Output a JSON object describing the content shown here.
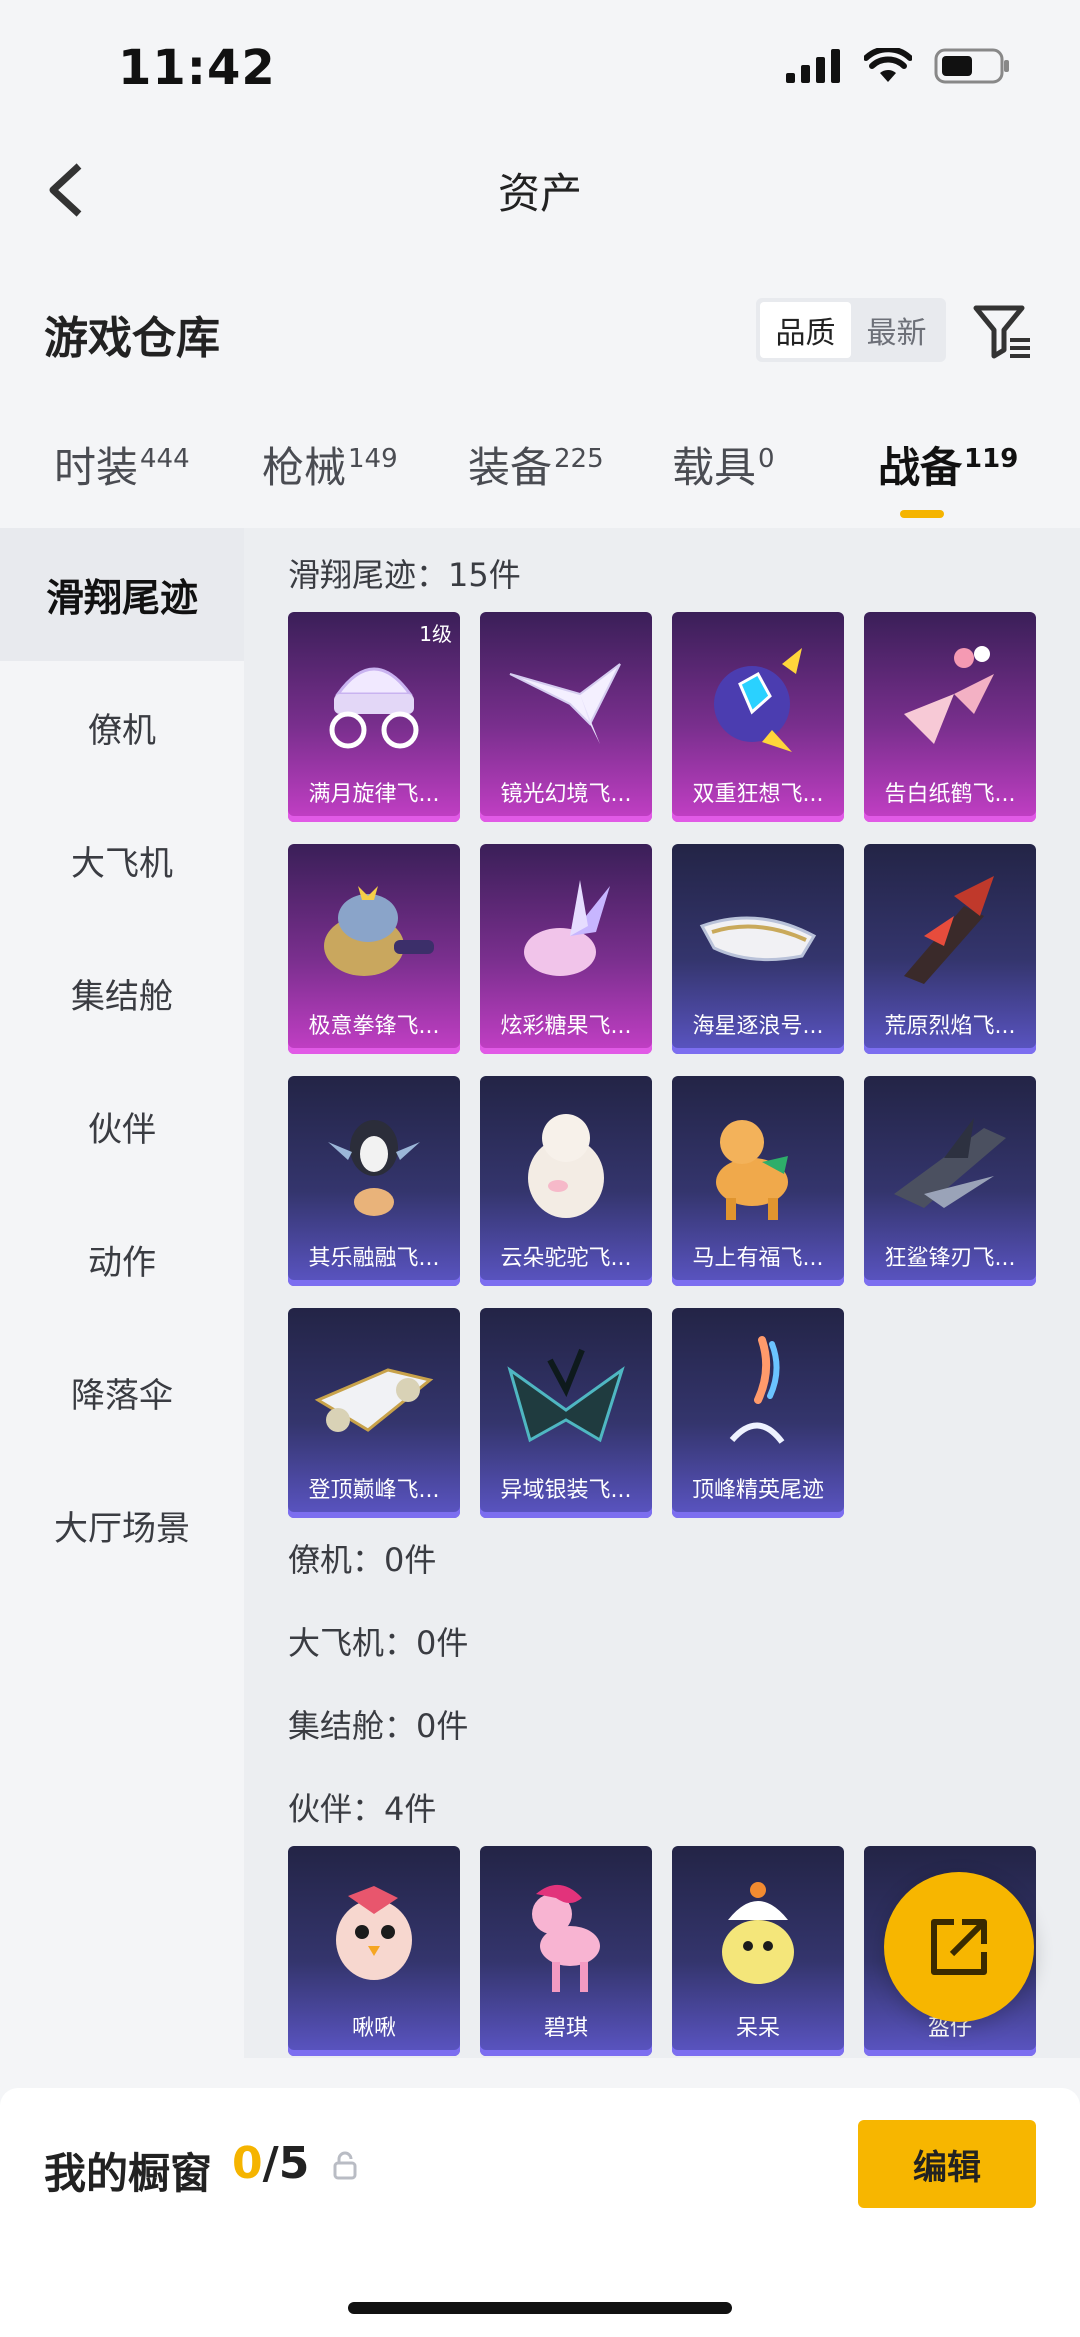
{
  "status": {
    "time": "11:42"
  },
  "nav": {
    "title": "资产"
  },
  "header": {
    "title": "游戏仓库",
    "sort": [
      "品质",
      "最新"
    ]
  },
  "tabs": [
    {
      "label": "时装",
      "count": "444"
    },
    {
      "label": "枪械",
      "count": "149"
    },
    {
      "label": "装备",
      "count": "225"
    },
    {
      "label": "载具",
      "count": "0"
    },
    {
      "label": "战备",
      "count": "119"
    }
  ],
  "sidebar": [
    "滑翔尾迹",
    "僚机",
    "大飞机",
    "集结舱",
    "伙伴",
    "动作",
    "降落伞",
    "大厅场景"
  ],
  "groups": {
    "trails": {
      "title": "滑翔尾迹：15件",
      "items": [
        {
          "name": "满月旋律飞...",
          "badge": "1级",
          "icon": "carriage"
        },
        {
          "name": "镜光幻境飞...",
          "icon": "wings"
        },
        {
          "name": "双重狂想飞...",
          "icon": "bomb"
        },
        {
          "name": "告白纸鹤飞...",
          "icon": "paper-crane"
        },
        {
          "name": "极意拳锋飞...",
          "icon": "elephant"
        },
        {
          "name": "炫彩糖果飞...",
          "icon": "candy"
        },
        {
          "name": "海星逐浪号...",
          "icon": "boat"
        },
        {
          "name": "荒原烈焰飞...",
          "icon": "flame-glider"
        },
        {
          "name": "其乐融融飞...",
          "icon": "penguin"
        },
        {
          "name": "云朵驼驼飞...",
          "icon": "alpaca"
        },
        {
          "name": "马上有福飞...",
          "icon": "horse"
        },
        {
          "name": "狂鲨锋刃飞...",
          "icon": "shark"
        },
        {
          "name": "登顶巅峰飞...",
          "icon": "jet"
        },
        {
          "name": "异域银装飞...",
          "icon": "dark-wings"
        },
        {
          "name": "顶峰精英尾迹",
          "icon": "smoke-trail"
        }
      ]
    },
    "wingman": {
      "title": "僚机：0件"
    },
    "plane": {
      "title": "大飞机：0件"
    },
    "capsule": {
      "title": "集结舱：0件"
    },
    "partners": {
      "title": "伙伴：4件",
      "items": [
        {
          "name": "啾啾",
          "icon": "chick-bird"
        },
        {
          "name": "碧琪",
          "icon": "pony"
        },
        {
          "name": "呆呆",
          "icon": "yellow-chick"
        },
        {
          "name": "盔仔",
          "icon": "helmet-buddy"
        }
      ]
    }
  },
  "bottom": {
    "showcase_label": "我的橱窗",
    "count_used": "0",
    "count_total": "/5",
    "edit_label": "编辑"
  },
  "colors": {
    "accent": "#f7b600",
    "card_purple": "#c43fc6",
    "card_blue": "#5b55c4"
  }
}
